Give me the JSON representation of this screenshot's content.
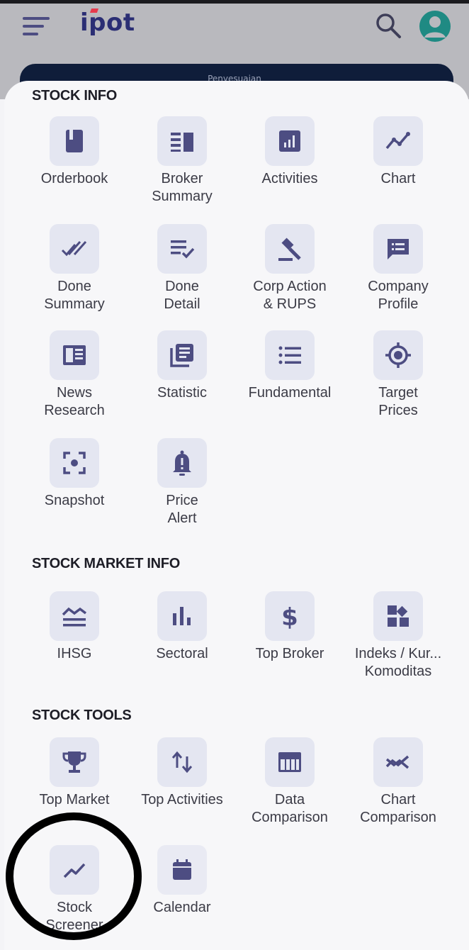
{
  "header": {
    "logo": "ipot",
    "menu_icon": "hamburger-menu-icon",
    "search_icon": "search-icon",
    "profile_icon": "account-circle-icon",
    "banner_text": "Penyesuaian"
  },
  "sections": [
    {
      "title": "STOCK INFO",
      "items": [
        {
          "label": "Orderbook",
          "icon": "book-icon"
        },
        {
          "label": "Broker\nSummary",
          "icon": "broker-summary-icon"
        },
        {
          "label": "Activities",
          "icon": "bar-chart-icon"
        },
        {
          "label": "Chart",
          "icon": "line-chart-icon"
        },
        {
          "label": "Done\nSummary",
          "icon": "double-check-icon"
        },
        {
          "label": "Done\nDetail",
          "icon": "list-check-icon"
        },
        {
          "label": "Corp Action\n& RUPS",
          "icon": "gavel-icon"
        },
        {
          "label": "Company\nProfile",
          "icon": "profile-card-icon"
        },
        {
          "label": "News\nResearch",
          "icon": "newspaper-icon"
        },
        {
          "label": "Statistic",
          "icon": "library-books-icon"
        },
        {
          "label": "Fundamental",
          "icon": "bullet-list-icon"
        },
        {
          "label": "Target\nPrices",
          "icon": "target-icon"
        },
        {
          "label": "Snapshot",
          "icon": "camera-frame-icon"
        },
        {
          "label": "Price\nAlert",
          "icon": "bell-alert-icon"
        }
      ]
    },
    {
      "title": "STOCK MARKET INFO",
      "items": [
        {
          "label": "IHSG",
          "icon": "index-wave-icon"
        },
        {
          "label": "Sectoral",
          "icon": "sector-bars-icon"
        },
        {
          "label": "Top Broker",
          "icon": "dollar-icon"
        },
        {
          "label": "Indeks / Kur...\nKomoditas",
          "icon": "grid-diamond-icon"
        }
      ]
    },
    {
      "title": "STOCK TOOLS",
      "items": [
        {
          "label": "Top Market",
          "icon": "trophy-icon"
        },
        {
          "label": "Top Activities",
          "icon": "up-down-arrows-icon"
        },
        {
          "label": "Data\nComparison",
          "icon": "table-icon"
        },
        {
          "label": "Chart\nComparison",
          "icon": "cross-lines-icon"
        },
        {
          "label": "Stock\nScreener",
          "icon": "trend-line-icon"
        },
        {
          "label": "Calendar",
          "icon": "calendar-icon"
        }
      ]
    }
  ],
  "colors": {
    "icon_fg": "#4d4d82",
    "icon_bg": "#e4e6f1",
    "highlight_circle": "#000000"
  }
}
